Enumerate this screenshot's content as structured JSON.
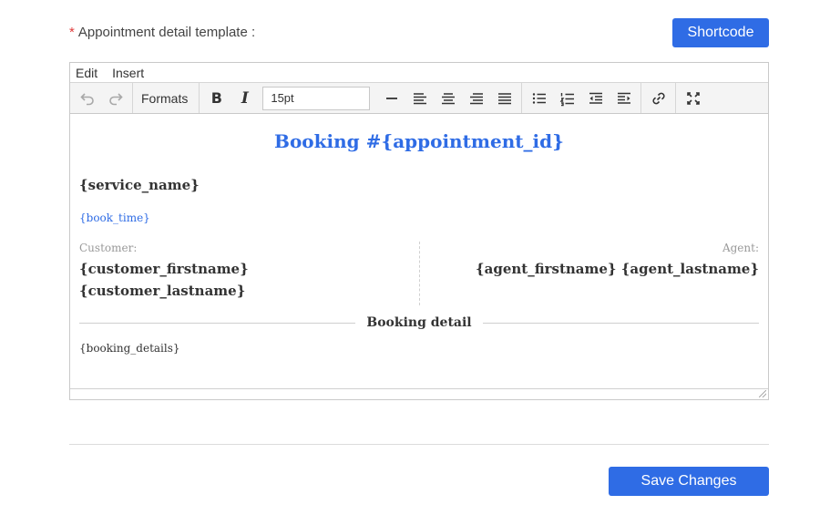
{
  "field": {
    "required_mark": "*",
    "label": "Appointment detail template :"
  },
  "shortcode_button": "Shortcode",
  "editor": {
    "menu": [
      "Edit",
      "Insert"
    ],
    "toolbar": {
      "formats_label": "Formats",
      "font_size": "15pt",
      "icons": [
        "undo-icon",
        "redo-icon",
        "bold-icon",
        "italic-icon",
        "horizontal-rule-icon",
        "align-left-icon",
        "align-center-icon",
        "align-right-icon",
        "align-justify-icon",
        "bullet-list-icon",
        "numbered-list-icon",
        "outdent-icon",
        "indent-icon",
        "link-icon",
        "fullscreen-icon"
      ],
      "bold_glyph": "B",
      "italic_glyph": "I"
    },
    "content": {
      "title": "Booking #{appointment_id}",
      "service": "{service_name}",
      "time": "{book_time}",
      "customer_label": "Customer:",
      "customer_firstname": "{customer_firstname}",
      "customer_lastname": "{customer_lastname}",
      "agent_label": "Agent:",
      "agent_name": "{agent_firstname} {agent_lastname}",
      "section_title": "Booking detail",
      "details": "{booking_details}"
    }
  },
  "colors": {
    "accent": "#2f6ce5",
    "required": "#e03b3b"
  },
  "save_button": "Save Changes"
}
